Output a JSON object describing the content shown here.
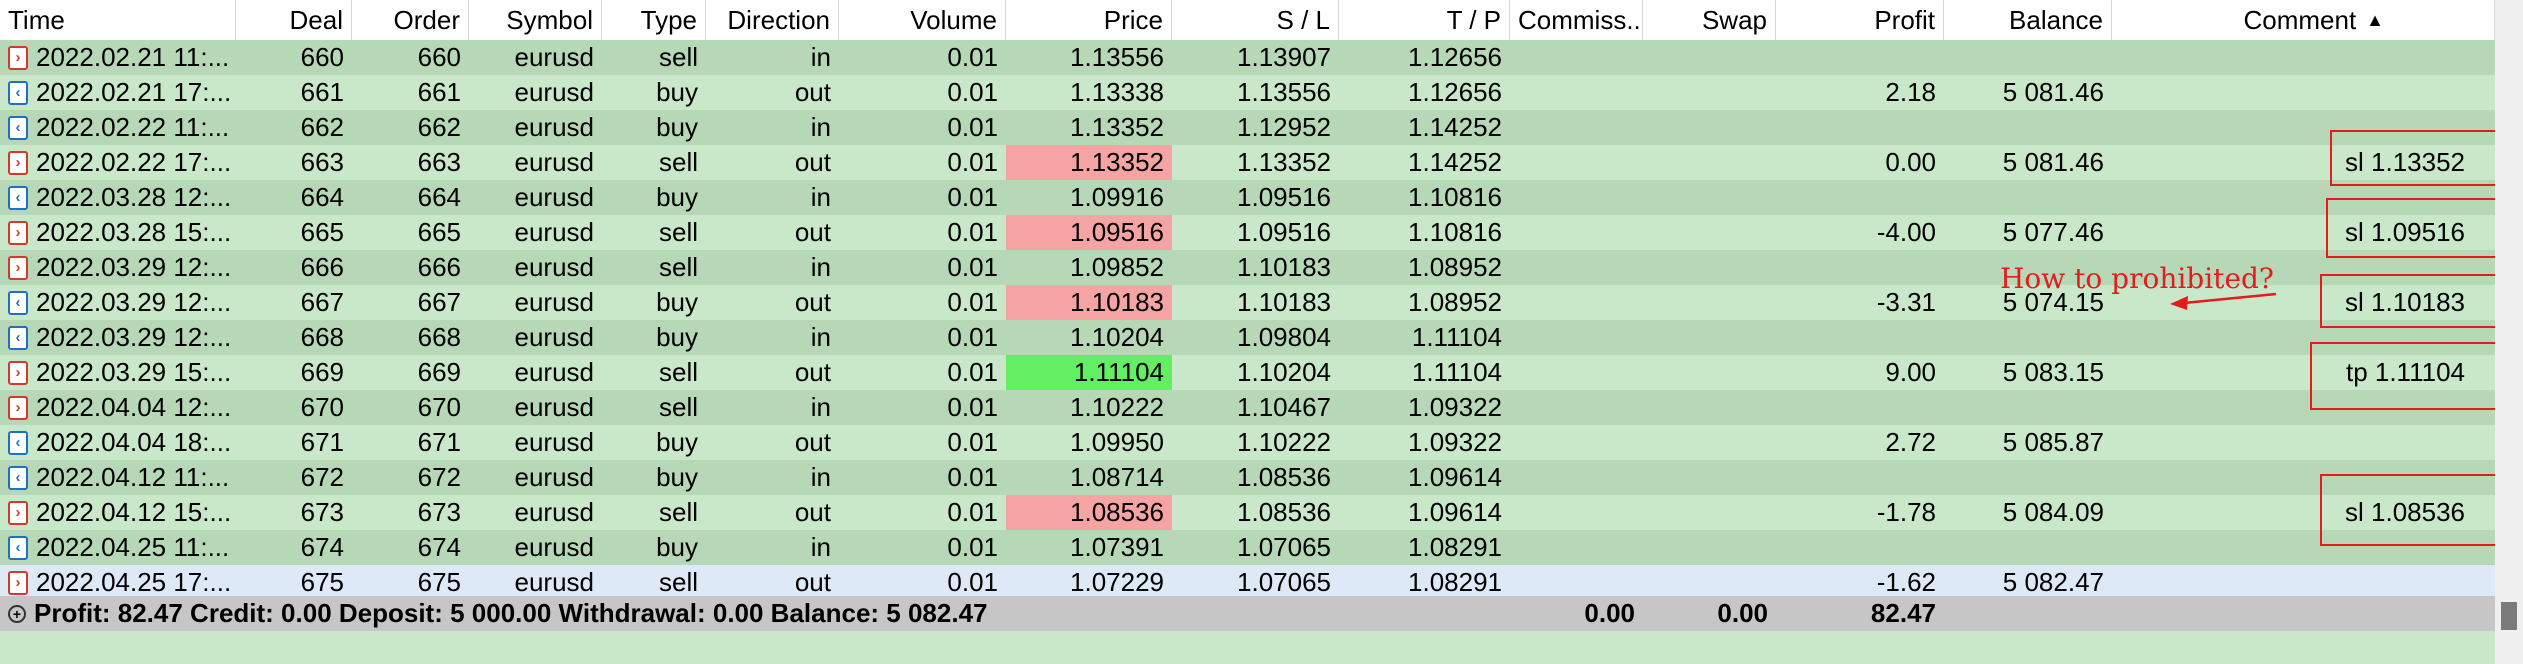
{
  "columns": [
    "Time",
    "Deal",
    "Order",
    "Symbol",
    "Type",
    "Direction",
    "Volume",
    "Price",
    "S / L",
    "T / P",
    "Commiss...",
    "Swap",
    "Profit",
    "Balance",
    "Comment"
  ],
  "sort_indicator": "▲",
  "rows": [
    {
      "time": "2022.02.21 11:...",
      "deal": "660",
      "order": "660",
      "symbol": "eurusd",
      "type": "sell",
      "direction": "in",
      "volume": "0.01",
      "price": "1.13556",
      "sl": "1.13907",
      "tp": "1.12656",
      "profit": "",
      "balance": "",
      "comment": "",
      "price_hl": "none"
    },
    {
      "time": "2022.02.21 17:...",
      "deal": "661",
      "order": "661",
      "symbol": "eurusd",
      "type": "buy",
      "direction": "out",
      "volume": "0.01",
      "price": "1.13338",
      "sl": "1.13556",
      "tp": "1.12656",
      "profit": "2.18",
      "balance": "5 081.46",
      "comment": "",
      "price_hl": "none"
    },
    {
      "time": "2022.02.22 11:...",
      "deal": "662",
      "order": "662",
      "symbol": "eurusd",
      "type": "buy",
      "direction": "in",
      "volume": "0.01",
      "price": "1.13352",
      "sl": "1.12952",
      "tp": "1.14252",
      "profit": "",
      "balance": "",
      "comment": "",
      "price_hl": "none"
    },
    {
      "time": "2022.02.22 17:...",
      "deal": "663",
      "order": "663",
      "symbol": "eurusd",
      "type": "sell",
      "direction": "out",
      "volume": "0.01",
      "price": "1.13352",
      "sl": "1.13352",
      "tp": "1.14252",
      "profit": "0.00",
      "balance": "5 081.46",
      "comment": "sl 1.13352",
      "price_hl": "red"
    },
    {
      "time": "2022.03.28 12:...",
      "deal": "664",
      "order": "664",
      "symbol": "eurusd",
      "type": "buy",
      "direction": "in",
      "volume": "0.01",
      "price": "1.09916",
      "sl": "1.09516",
      "tp": "1.10816",
      "profit": "",
      "balance": "",
      "comment": "",
      "price_hl": "none"
    },
    {
      "time": "2022.03.28 15:...",
      "deal": "665",
      "order": "665",
      "symbol": "eurusd",
      "type": "sell",
      "direction": "out",
      "volume": "0.01",
      "price": "1.09516",
      "sl": "1.09516",
      "tp": "1.10816",
      "profit": "-4.00",
      "balance": "5 077.46",
      "comment": "sl 1.09516",
      "price_hl": "red"
    },
    {
      "time": "2022.03.29 12:...",
      "deal": "666",
      "order": "666",
      "symbol": "eurusd",
      "type": "sell",
      "direction": "in",
      "volume": "0.01",
      "price": "1.09852",
      "sl": "1.10183",
      "tp": "1.08952",
      "profit": "",
      "balance": "",
      "comment": "",
      "price_hl": "none"
    },
    {
      "time": "2022.03.29 12:...",
      "deal": "667",
      "order": "667",
      "symbol": "eurusd",
      "type": "buy",
      "direction": "out",
      "volume": "0.01",
      "price": "1.10183",
      "sl": "1.10183",
      "tp": "1.08952",
      "profit": "-3.31",
      "balance": "5 074.15",
      "comment": "sl 1.10183",
      "price_hl": "red"
    },
    {
      "time": "2022.03.29 12:...",
      "deal": "668",
      "order": "668",
      "symbol": "eurusd",
      "type": "buy",
      "direction": "in",
      "volume": "0.01",
      "price": "1.10204",
      "sl": "1.09804",
      "tp": "1.11104",
      "profit": "",
      "balance": "",
      "comment": "",
      "price_hl": "none"
    },
    {
      "time": "2022.03.29 15:...",
      "deal": "669",
      "order": "669",
      "symbol": "eurusd",
      "type": "sell",
      "direction": "out",
      "volume": "0.01",
      "price": "1.11104",
      "sl": "1.10204",
      "tp": "1.11104",
      "profit": "9.00",
      "balance": "5 083.15",
      "comment": "tp 1.11104",
      "price_hl": "green"
    },
    {
      "time": "2022.04.04 12:...",
      "deal": "670",
      "order": "670",
      "symbol": "eurusd",
      "type": "sell",
      "direction": "in",
      "volume": "0.01",
      "price": "1.10222",
      "sl": "1.10467",
      "tp": "1.09322",
      "profit": "",
      "balance": "",
      "comment": "",
      "price_hl": "none"
    },
    {
      "time": "2022.04.04 18:...",
      "deal": "671",
      "order": "671",
      "symbol": "eurusd",
      "type": "buy",
      "direction": "out",
      "volume": "0.01",
      "price": "1.09950",
      "sl": "1.10222",
      "tp": "1.09322",
      "profit": "2.72",
      "balance": "5 085.87",
      "comment": "",
      "price_hl": "none"
    },
    {
      "time": "2022.04.12 11:...",
      "deal": "672",
      "order": "672",
      "symbol": "eurusd",
      "type": "buy",
      "direction": "in",
      "volume": "0.01",
      "price": "1.08714",
      "sl": "1.08536",
      "tp": "1.09614",
      "profit": "",
      "balance": "",
      "comment": "",
      "price_hl": "none"
    },
    {
      "time": "2022.04.12 15:...",
      "deal": "673",
      "order": "673",
      "symbol": "eurusd",
      "type": "sell",
      "direction": "out",
      "volume": "0.01",
      "price": "1.08536",
      "sl": "1.08536",
      "tp": "1.09614",
      "profit": "-1.78",
      "balance": "5 084.09",
      "comment": "sl 1.08536",
      "price_hl": "red"
    },
    {
      "time": "2022.04.25 11:...",
      "deal": "674",
      "order": "674",
      "symbol": "eurusd",
      "type": "buy",
      "direction": "in",
      "volume": "0.01",
      "price": "1.07391",
      "sl": "1.07065",
      "tp": "1.08291",
      "profit": "",
      "balance": "",
      "comment": "",
      "price_hl": "none"
    },
    {
      "time": "2022.04.25 17:...",
      "deal": "675",
      "order": "675",
      "symbol": "eurusd",
      "type": "sell",
      "direction": "out",
      "volume": "0.01",
      "price": "1.07229",
      "sl": "1.07065",
      "tp": "1.08291",
      "profit": "-1.62",
      "balance": "5 082.47",
      "comment": "",
      "price_hl": "none"
    }
  ],
  "selected_row": 15,
  "footer": {
    "summary": "Profit: 82.47  Credit: 0.00  Deposit: 5 000.00  Withdrawal: 0.00  Balance: 5 082.47",
    "commission": "0.00",
    "swap": "0.00",
    "profit": "82.47"
  },
  "annotation": {
    "note": "How to prohibited?"
  },
  "colors": {
    "row_light": "#c9e8c9",
    "row_dark": "#b6d8b6",
    "highlight_red": "#f6a3a3",
    "highlight_green": "#63ee63",
    "annotation_red": "#e31c1c"
  }
}
